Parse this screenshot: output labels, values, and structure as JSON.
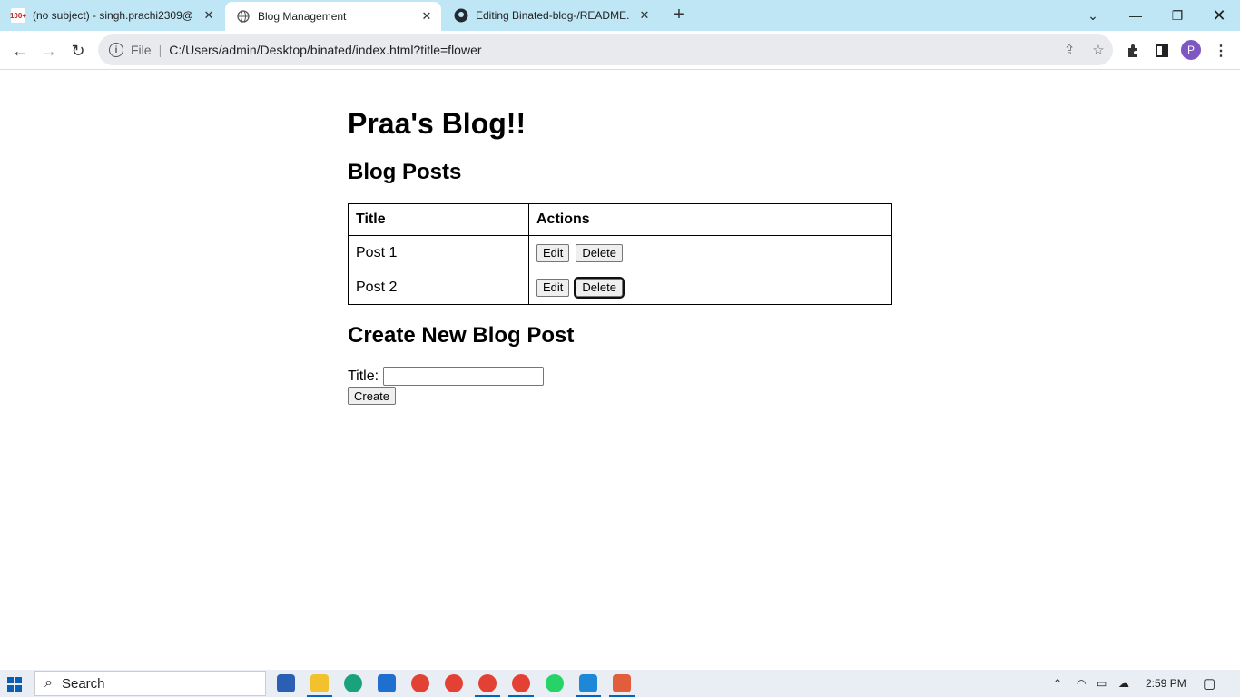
{
  "browser": {
    "tabs": [
      {
        "title": "(no subject) - singh.prachi2309@",
        "favicon": "gmail-icon",
        "badge": "100+"
      },
      {
        "title": "Blog Management",
        "favicon": "globe-icon"
      },
      {
        "title": "Editing Binated-blog-/README.",
        "favicon": "github-icon"
      }
    ],
    "scheme_label": "File",
    "url": "C:/Users/admin/Desktop/binated/index.html?title=flower",
    "profile_initial": "P"
  },
  "page": {
    "heading": "Praa's Blog!!",
    "posts_heading": "Blog Posts",
    "table": {
      "headers": [
        "Title",
        "Actions"
      ],
      "rows": [
        {
          "title": "Post 1",
          "edit_label": "Edit",
          "delete_label": "Delete"
        },
        {
          "title": "Post 2",
          "edit_label": "Edit",
          "delete_label": "Delete"
        }
      ]
    },
    "create_heading": "Create New Blog Post",
    "title_label": "Title:",
    "title_value": "",
    "create_label": "Create"
  },
  "taskbar": {
    "search_placeholder": "Search",
    "time": "2:59 PM"
  },
  "colors": {
    "tabbar_bg": "#bfe6f4",
    "accent": "#0067c0"
  }
}
